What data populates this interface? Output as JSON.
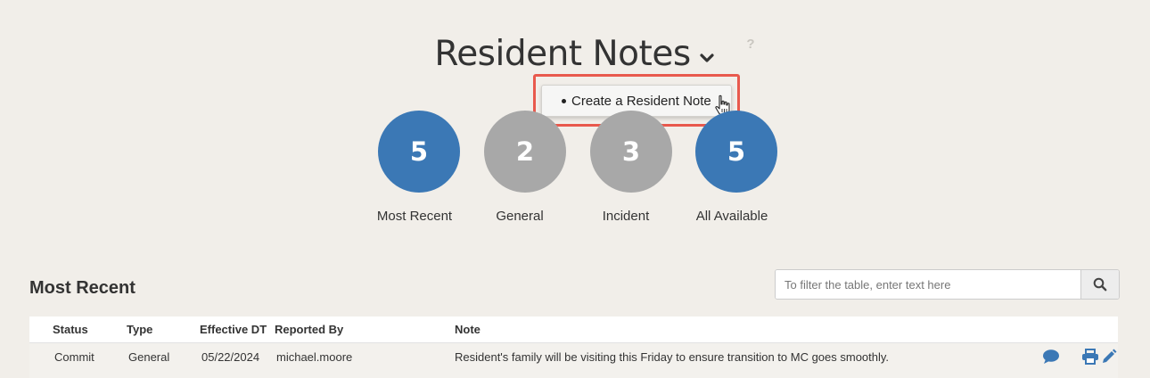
{
  "header": {
    "title": "Resident Notes",
    "help_label": "?"
  },
  "dropdown": {
    "item_label": "Create a Resident Note"
  },
  "summary": [
    {
      "count": "5",
      "label": "Most Recent",
      "color": "#3b78b5"
    },
    {
      "count": "2",
      "label": "General",
      "color": "#a8a8a8"
    },
    {
      "count": "3",
      "label": "Incident",
      "color": "#a8a8a8"
    },
    {
      "count": "5",
      "label": "All Available",
      "color": "#3b78b5"
    }
  ],
  "section": {
    "title": "Most Recent"
  },
  "filter": {
    "placeholder": "To filter the table, enter text here"
  },
  "table": {
    "columns": [
      "Status",
      "Type",
      "Effective DT",
      "Reported By",
      "Note"
    ],
    "rows": [
      {
        "status": "Commit",
        "type": "General",
        "effective_dt": "05/22/2024",
        "reported_by": "michael.moore",
        "note": "Resident's family will be visiting this Friday to ensure transition to MC goes smoothly."
      }
    ]
  },
  "icons": {
    "comment": "comment-icon",
    "print": "print-icon",
    "edit": "edit-icon",
    "search": "search-icon",
    "chevron": "chevron-down-icon",
    "cursor": "hand-cursor-icon"
  },
  "colors": {
    "accent_blue": "#3b78b5",
    "highlight_red": "#e8594d",
    "inactive_gray": "#a8a8a8"
  }
}
